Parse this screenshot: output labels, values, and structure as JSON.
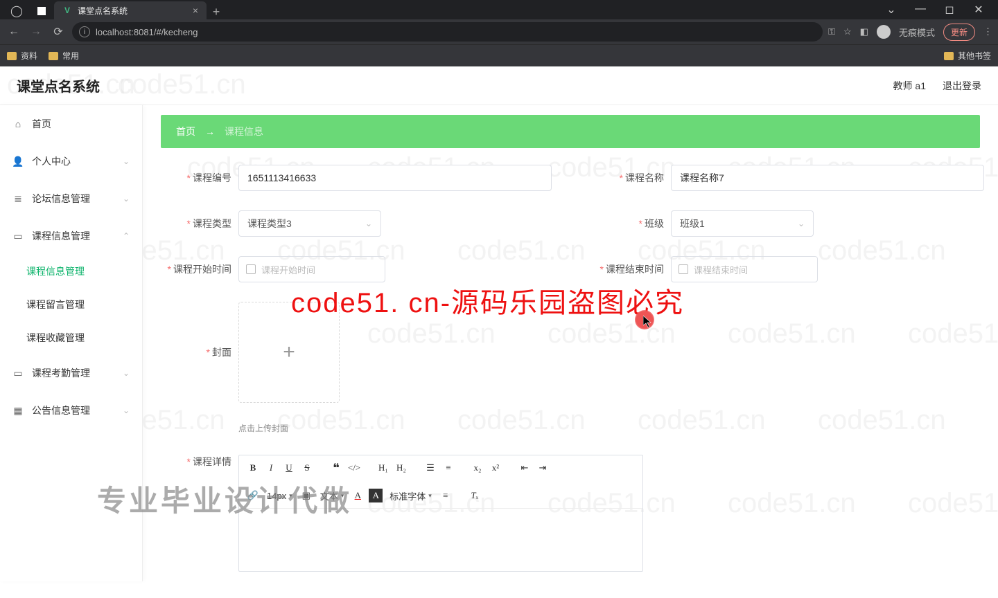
{
  "browser": {
    "tab_title": "课堂点名系统",
    "url_display": "localhost:8081/#/kecheng",
    "bookmarks": [
      "资料",
      "常用"
    ],
    "other_bookmarks": "其他书签",
    "incognito_label": "无痕模式",
    "update_label": "更新"
  },
  "app": {
    "title": "课堂点名系统",
    "teacher_label": "教师 a1",
    "logout_label": "退出登录"
  },
  "sidebar": {
    "home": "首页",
    "personal": "个人中心",
    "forum": "论坛信息管理",
    "course": "课程信息管理",
    "sub_course_info": "课程信息管理",
    "sub_course_msg": "课程留言管理",
    "sub_course_fav": "课程收藏管理",
    "attendance": "课程考勤管理",
    "notice": "公告信息管理"
  },
  "breadcrumb": {
    "home": "首页",
    "arrow": "→",
    "current": "课程信息"
  },
  "form": {
    "course_no_label": "课程编号",
    "course_no_value": "1651113416633",
    "course_name_label": "课程名称",
    "course_name_value": "课程名称7",
    "course_type_label": "课程类型",
    "course_type_value": "课程类型3",
    "class_label": "班级",
    "class_value": "班级1",
    "start_time_label": "课程开始时间",
    "start_time_placeholder": "课程开始时间",
    "end_time_label": "课程结束时间",
    "end_time_placeholder": "课程结束时间",
    "cover_label": "封面",
    "upload_tip": "点击上传封面",
    "detail_label": "课程详情"
  },
  "editor": {
    "size_value": "14px",
    "font_label": "文本",
    "font_family_label": "标准字体"
  },
  "watermarks": {
    "repeat": "code51.cn",
    "center_red": "code51. cn-源码乐园盗图必究",
    "bottom": "专业毕业设计代做"
  }
}
